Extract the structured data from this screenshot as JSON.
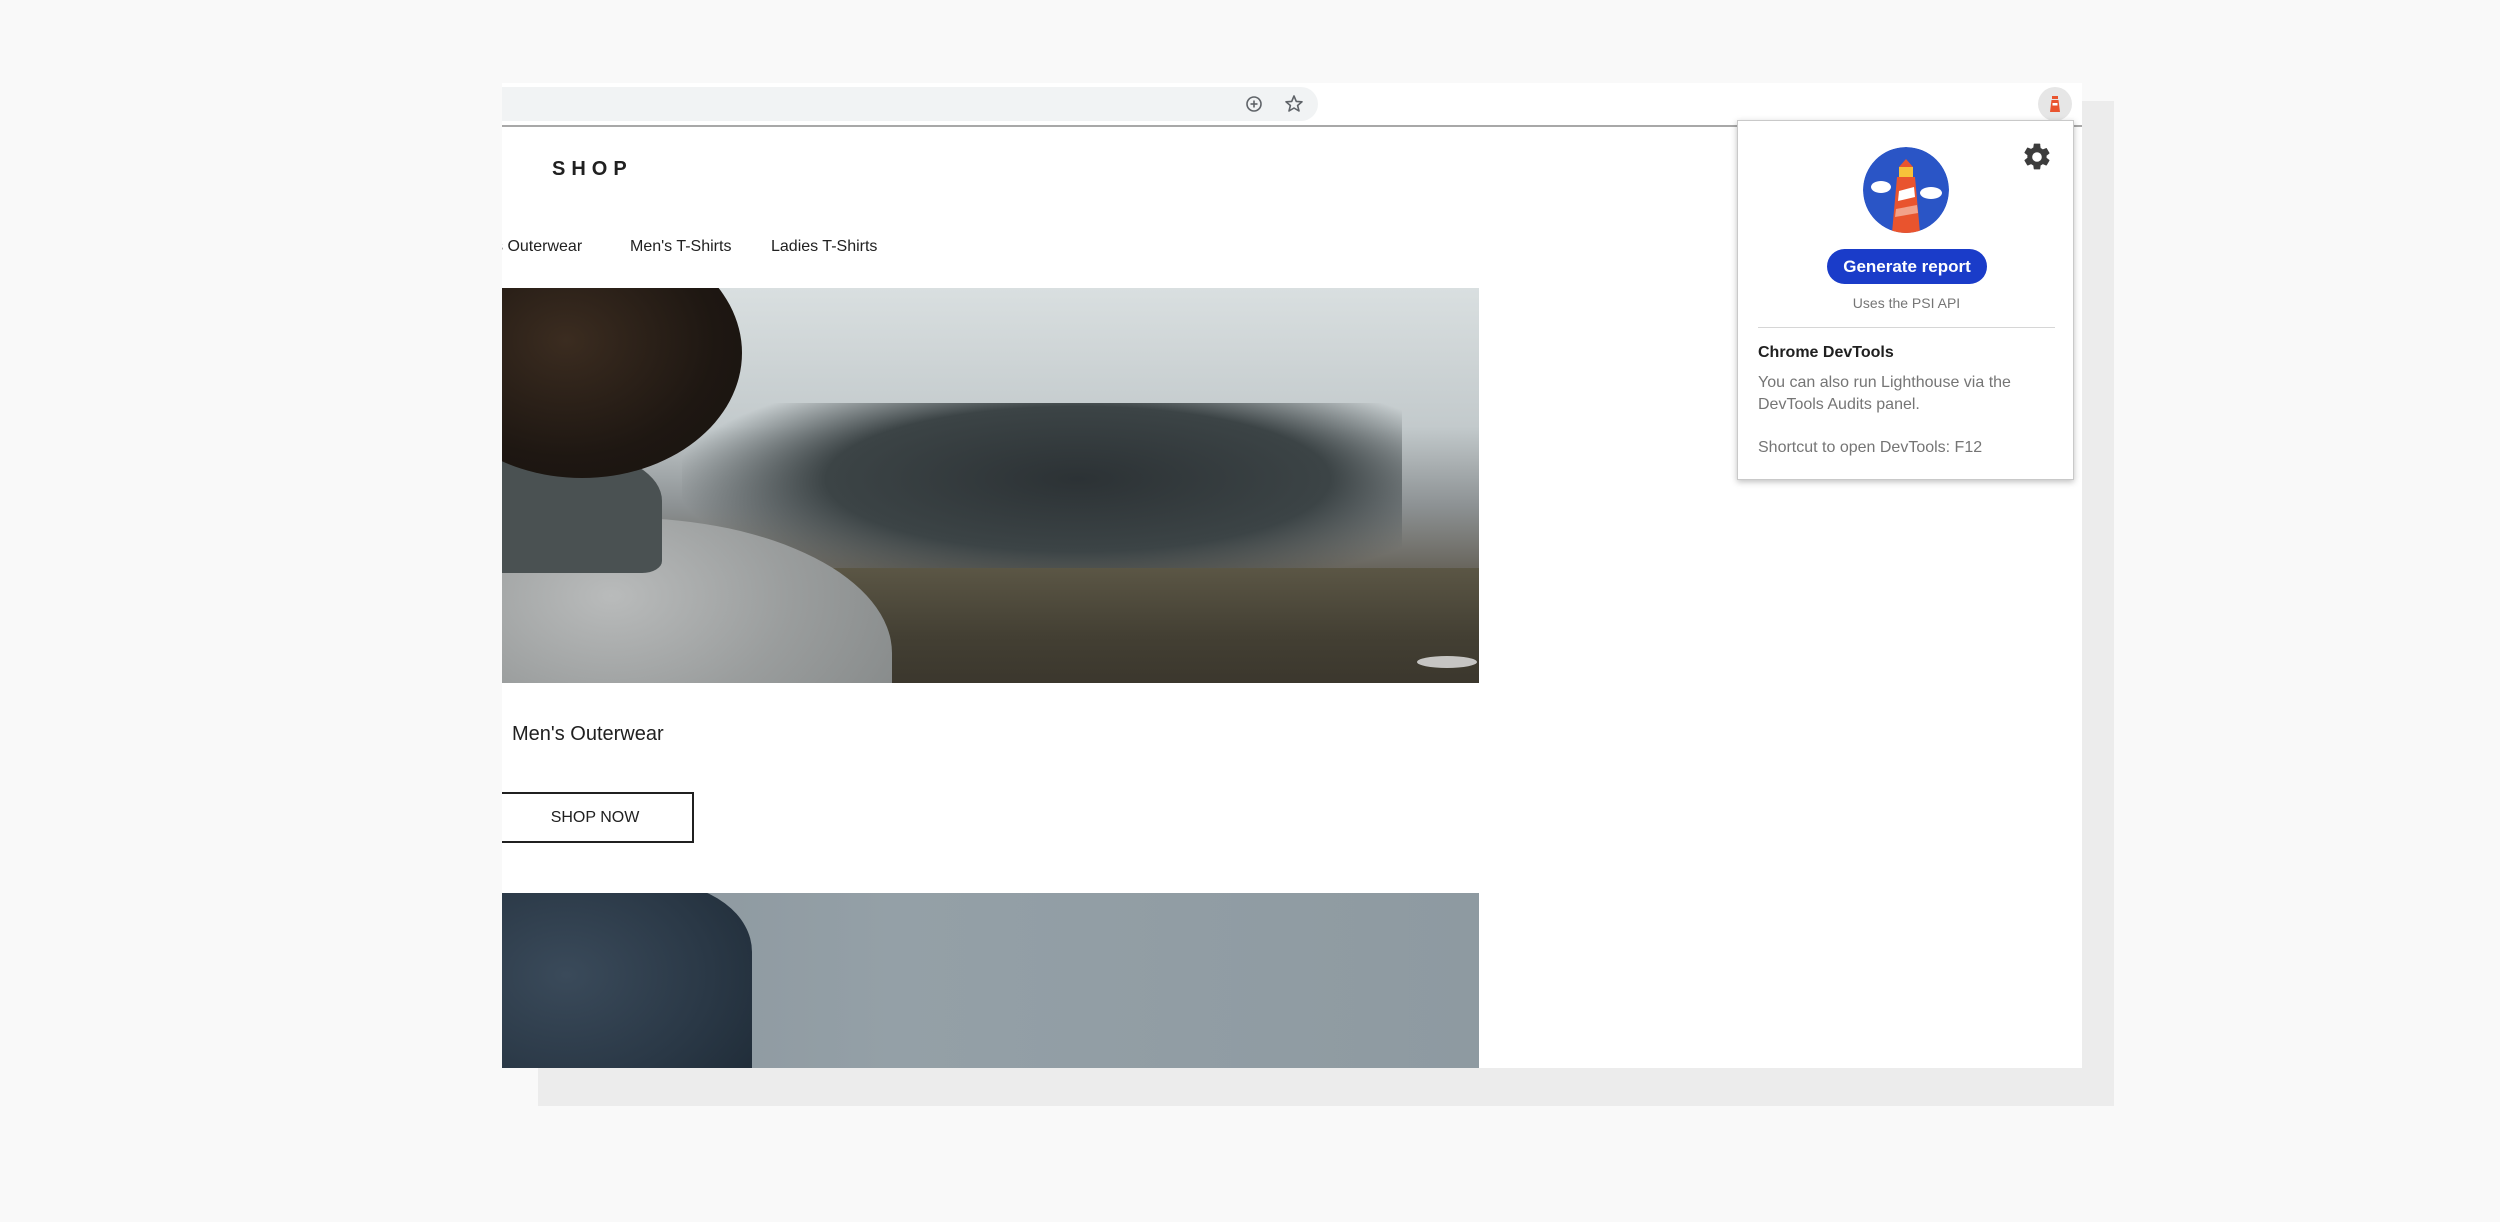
{
  "browser": {
    "toolbar": {
      "zoom_icon": "zoom-plus-icon",
      "bookmark_icon": "star-icon",
      "extension_icon": "lighthouse-icon"
    }
  },
  "page": {
    "brand": "SHOP",
    "nav": [
      {
        "label": "s Outerwear"
      },
      {
        "label": "Men's T-Shirts"
      },
      {
        "label": "Ladies T-Shirts"
      }
    ],
    "card": {
      "title": "Men's Outerwear",
      "button_label": "SHOP NOW"
    }
  },
  "popup": {
    "settings_icon": "gear-icon",
    "logo_icon": "lighthouse-logo-icon",
    "generate_label": "Generate report",
    "psi_note": "Uses the PSI API",
    "devtools_heading": "Chrome DevTools",
    "devtools_body": "You can also run Lighthouse via the DevTools Audits panel.",
    "devtools_shortcut": "Shortcut to open DevTools: F12"
  },
  "colors": {
    "accent_button": "#1a3cc9",
    "logo_circle": "#2a55c6",
    "lighthouse_tower": "#e9542e"
  }
}
